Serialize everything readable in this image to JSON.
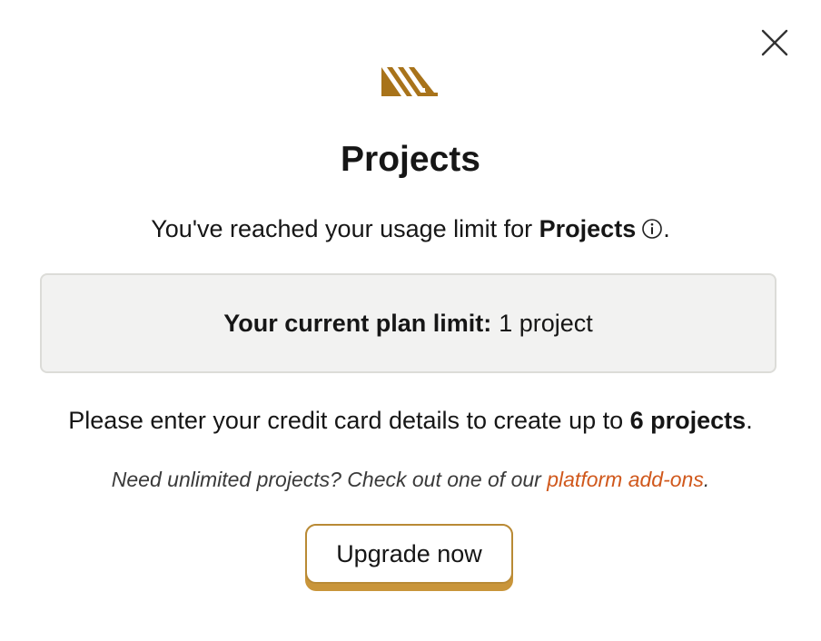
{
  "dialog": {
    "close_icon": "close-icon",
    "logo_icon": "brand-logo-icon",
    "title": "Projects",
    "usage": {
      "prefix": "You've reached your usage limit for ",
      "feature": "Projects",
      "info_icon": "info-icon",
      "suffix": "."
    },
    "plan_limit": {
      "label": "Your current plan limit:",
      "value": "1 project"
    },
    "credit": {
      "prefix": "Please enter your credit card details to create up to ",
      "amount": "6 projects",
      "suffix": "."
    },
    "addons": {
      "prefix": "Need unlimited projects? Check out one of our ",
      "link": "platform add-ons",
      "suffix": "."
    },
    "upgrade_label": "Upgrade now"
  },
  "colors": {
    "brand": "#A8731A",
    "link": "#D0581C",
    "button_shadow": "#C9953A",
    "box_background": "#F2F2F1"
  }
}
